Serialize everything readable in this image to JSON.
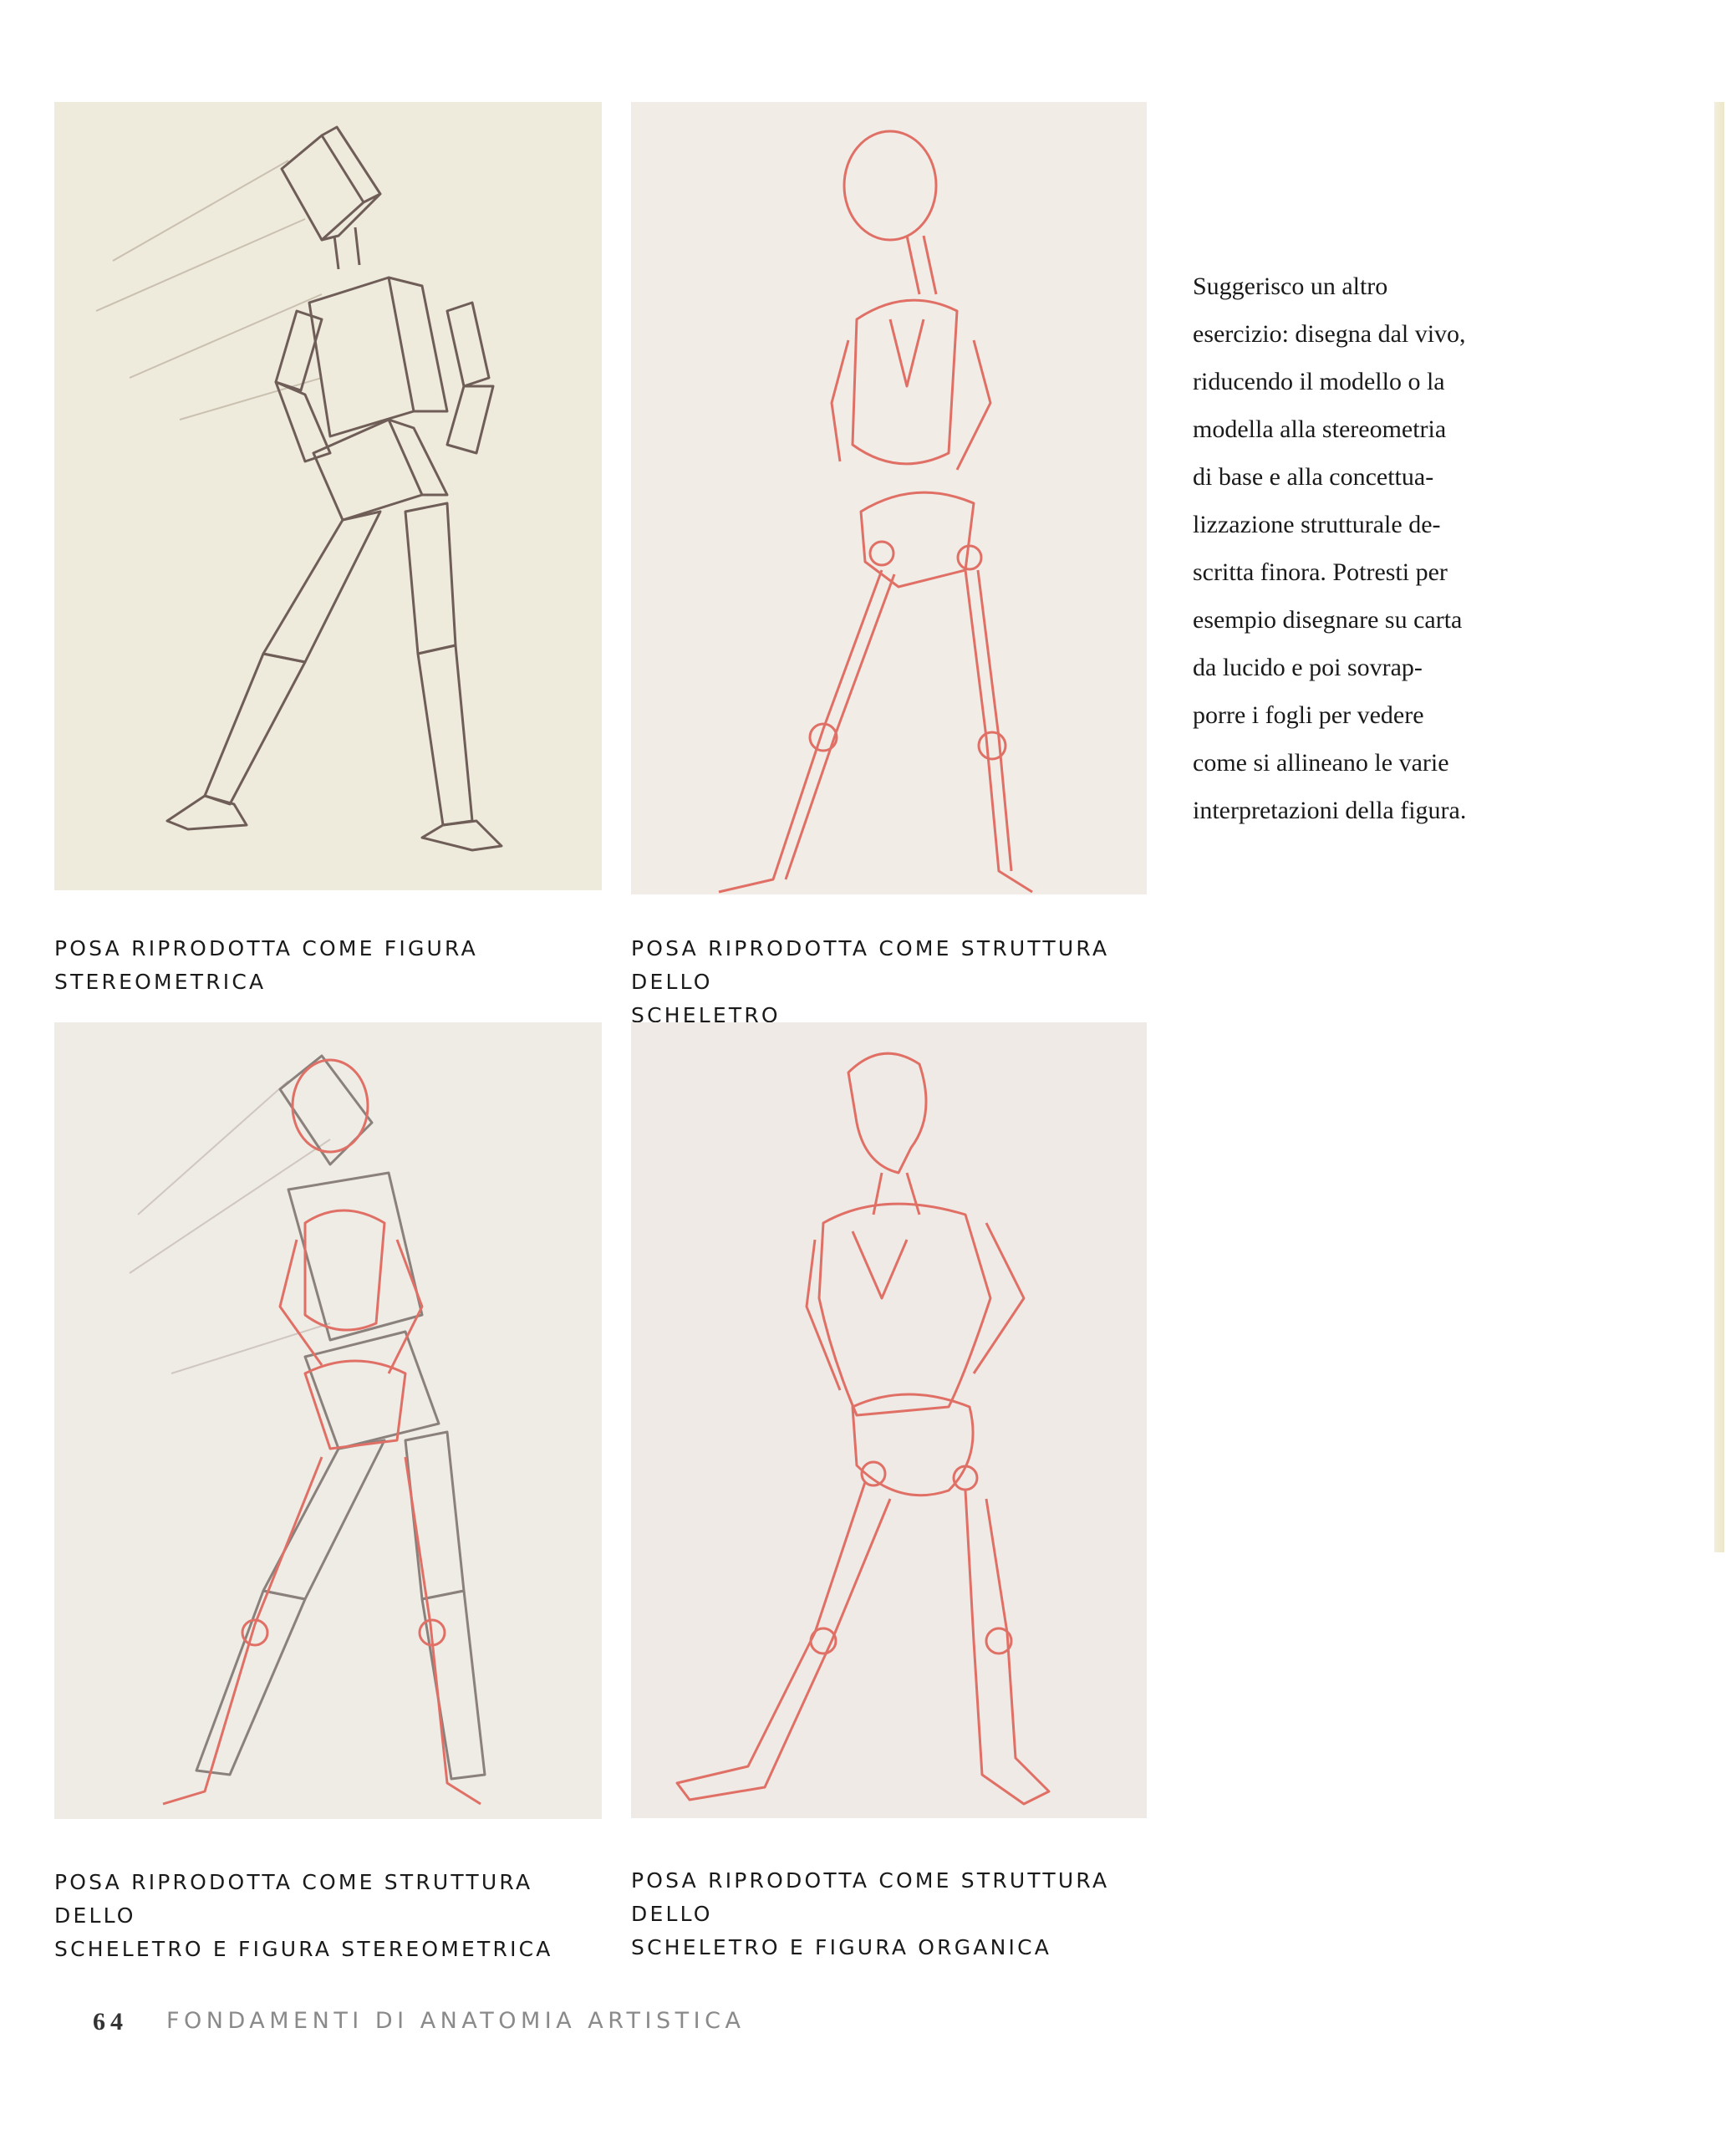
{
  "page": {
    "body_text": [
      "Suggerisco un altro",
      "esercizio: disegna dal vivo,",
      "riducendo il modello o la",
      "modella alla stereometria",
      "di base e alla concettua-",
      "lizzazione strutturale de-",
      "scritta finora. Potresti per",
      "esempio disegnare su carta",
      "da lucido e poi sovrap-",
      "porre i fogli per vedere",
      "come si allineano le varie",
      "interpretazioni della figura."
    ],
    "folio": "64",
    "running_title": "FONDAMENTI DI ANATOMIA ARTISTICA"
  },
  "figures": [
    {
      "caption_lines": [
        "POSA RIPRODOTTA COME FIGURA STEREOMETRICA"
      ],
      "paper_color": "#efebdc"
    },
    {
      "caption_lines": [
        "POSA RIPRODOTTA COME STRUTTURA DELLO",
        "SCHELETRO"
      ],
      "paper_color": "#f1ece6"
    },
    {
      "caption_lines": [
        "POSA RIPRODOTTA COME STRUTTURA DELLO",
        "SCHELETRO E FIGURA STEREOMETRICA"
      ],
      "paper_color": "#efebe5"
    },
    {
      "caption_lines": [
        "POSA RIPRODOTTA COME STRUTTURA DELLO",
        "SCHELETRO E FIGURA ORGANICA"
      ],
      "paper_color": "#efeae5"
    }
  ],
  "colors": {
    "graphite": "#6f5d58",
    "red_pencil": "#e07066"
  }
}
